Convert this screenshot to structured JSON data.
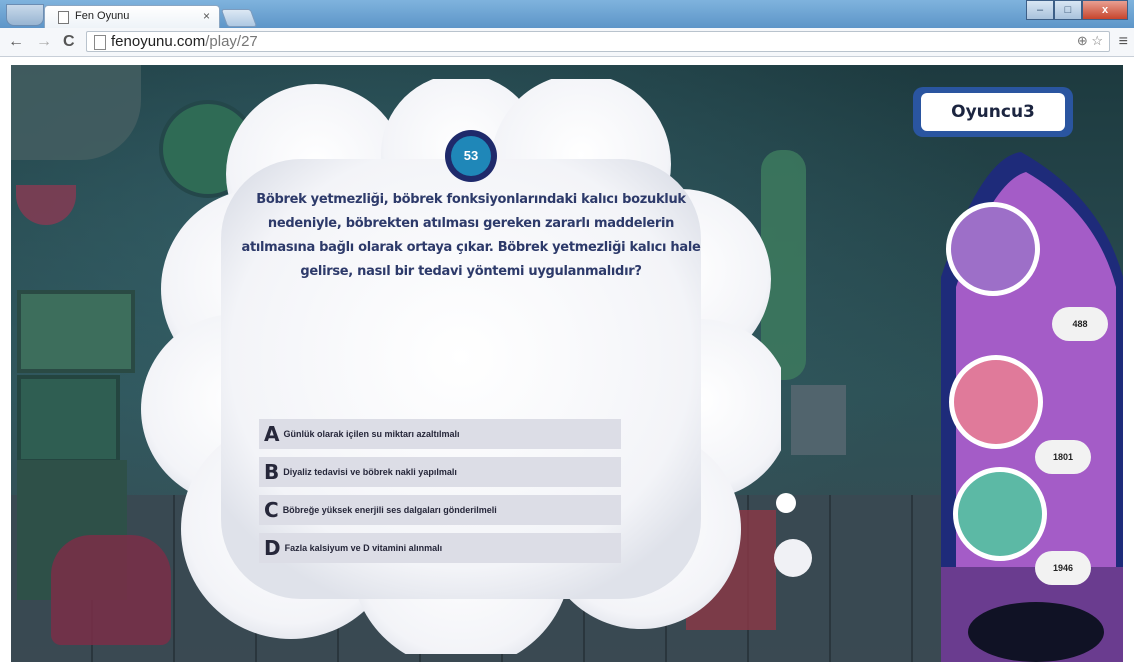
{
  "browser": {
    "tab_title": "Fen Oyunu",
    "tab_close": "×",
    "url_host": "fenoyunu.com",
    "url_path": "/play/27",
    "back": "←",
    "forward": "→",
    "reload": "C",
    "menu": "≡",
    "omni_icons": "⊕ ☆",
    "win_min": "–",
    "win_max": "□",
    "win_close": "x"
  },
  "game": {
    "question_number": "53",
    "question_text": "Böbrek yetmezliği, böbrek fonksiyonlarındaki kalıcı bozukluk nedeniyle, böbrekten atılması gereken zararlı maddelerin atılmasına bağlı olarak ortaya çıkar. Böbrek yetmezliği kalıcı hale gelirse, nasıl bir tedavi yöntemi uygulanmalıdır?",
    "answers": [
      {
        "letter": "A",
        "text": "Günlük olarak içilen su miktarı azaltılmalı"
      },
      {
        "letter": "B",
        "text": "Diyaliz tedavisi ve böbrek nakli yapılmalı"
      },
      {
        "letter": "C",
        "text": "Böbreğe yüksek enerjili ses dalgaları gönderilmeli"
      },
      {
        "letter": "D",
        "text": "Fazla kalsiyum ve D vitamini alınmalı"
      }
    ],
    "player_name": "Oyuncu3",
    "scores": [
      "488",
      "1801",
      "1946"
    ]
  },
  "colors": {
    "question_text": "#2d3a6a",
    "badge_ring": "#1f2a6b",
    "badge_fill": "#1f87b8",
    "rocket_purple": "#a45cc7",
    "answer_bg": "#dcdde6"
  }
}
